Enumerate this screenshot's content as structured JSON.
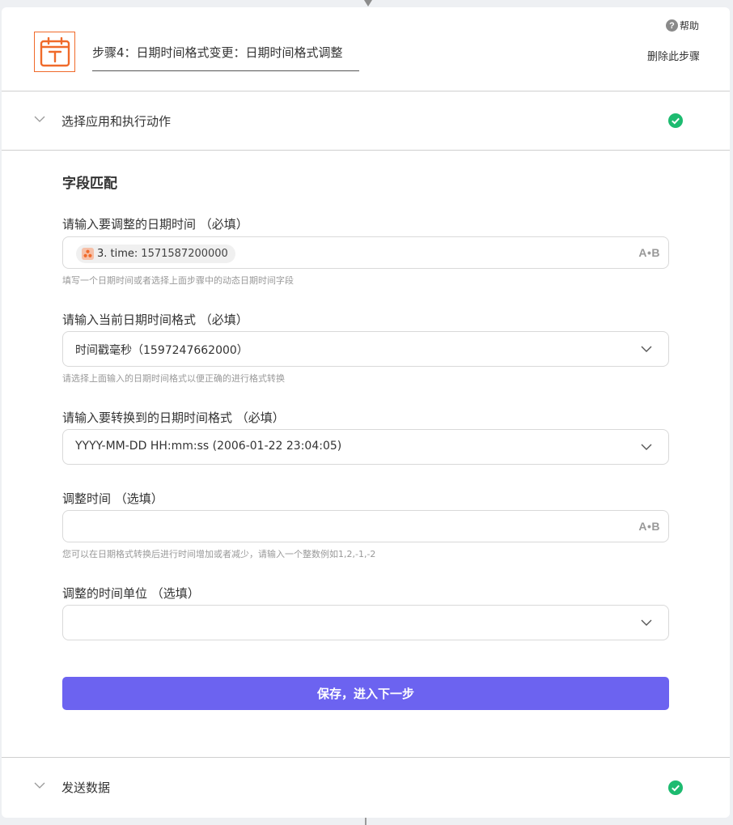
{
  "header": {
    "step_title": "步骤4：日期时间格式变更：日期时间格式调整",
    "help_label": "帮助",
    "help_icon_glyph": "?",
    "delete_label": "删除此步骤"
  },
  "sections": {
    "app_action": {
      "label": "选择应用和执行动作",
      "status": "complete"
    },
    "send_data": {
      "label": "发送数据",
      "status": "complete"
    }
  },
  "field_mapping": {
    "title": "字段匹配",
    "fields": [
      {
        "label": "请输入要调整的日期时间 （必填）",
        "pill_step": "3. time:",
        "pill_value": "1571587200000",
        "hint": "填写一个日期时间或者选择上面步骤中的动态日期时间字段",
        "ab_icon": "A•B"
      },
      {
        "label": "请输入当前日期时间格式 （必填）",
        "value": "时间戳毫秒（1597247662000）",
        "hint": "请选择上面输入的日期时间格式以便正确的进行格式转换"
      },
      {
        "label": "请输入要转换到的日期时间格式 （必填）",
        "value": "YYYY-MM-DD HH:mm:ss (2006-01-22 23:04:05)"
      },
      {
        "label": "调整时间 （选填）",
        "value": "",
        "hint": "您可以在日期格式转换后进行时间增加或者减少，请输入一个整数例如1,2,-1,-2",
        "ab_icon": "A•B"
      },
      {
        "label": "调整的时间单位 （选填）",
        "value": ""
      }
    ],
    "submit_label": "保存，进入下一步"
  },
  "colors": {
    "accent": "#6c63f0",
    "brand_orange": "#f06a2a",
    "success": "#1dbb70"
  }
}
